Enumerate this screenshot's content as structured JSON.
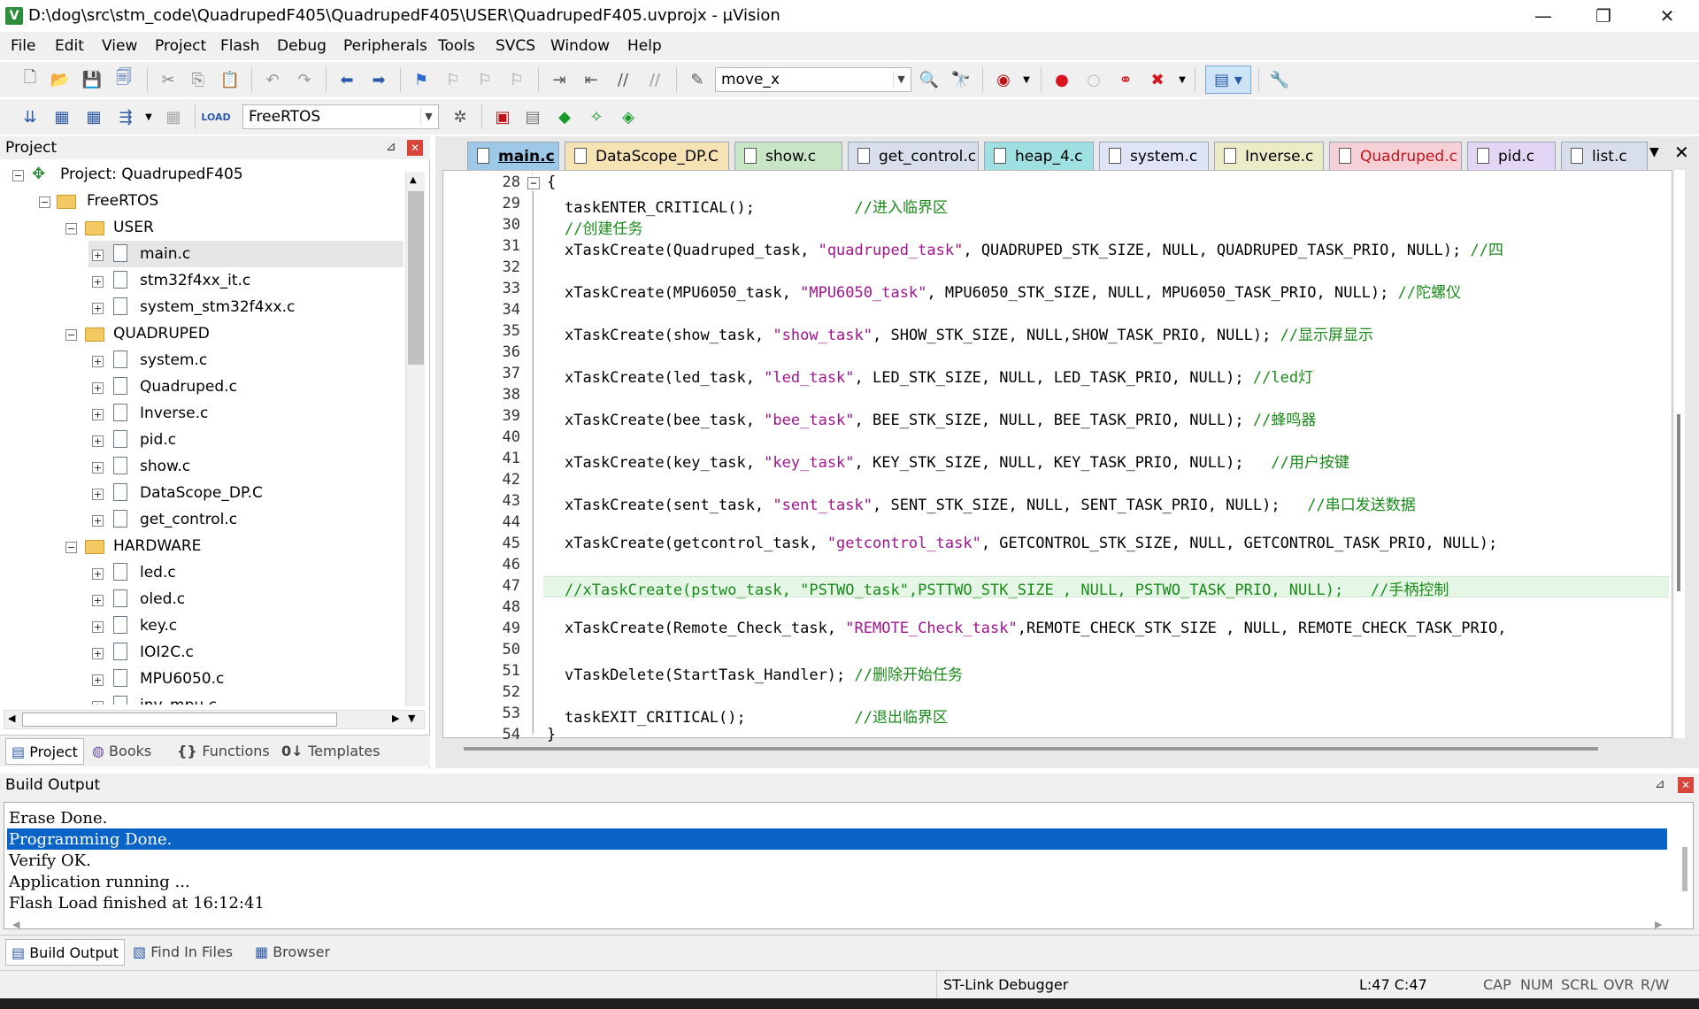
{
  "window": {
    "title": "D:\\dog\\src\\stm_code\\QuadrupedF405\\QuadrupedF405\\USER\\QuadrupedF405.uvprojx - µVision",
    "minimize": "—",
    "maximize": "❐",
    "close": "✕"
  },
  "menu": [
    "File",
    "Edit",
    "View",
    "Project",
    "Flash",
    "Debug",
    "Peripherals",
    "Tools",
    "SVCS",
    "Window",
    "Help"
  ],
  "toolbar": {
    "find_combo": "move_x",
    "target_combo": "FreeRTOS"
  },
  "project_panel": {
    "title": "Project",
    "root": "Project: QuadrupedF405",
    "target": "FreeRTOS",
    "groups": [
      {
        "name": "USER",
        "files": [
          "main.c",
          "stm32f4xx_it.c",
          "system_stm32f4xx.c"
        ]
      },
      {
        "name": "QUADRUPED",
        "files": [
          "system.c",
          "Quadruped.c",
          "Inverse.c",
          "pid.c",
          "show.c",
          "DataScope_DP.C",
          "get_control.c"
        ]
      },
      {
        "name": "HARDWARE",
        "files": [
          "led.c",
          "oled.c",
          "key.c",
          "IOI2C.c",
          "MPU6050.c",
          "inv_mpu.c"
        ]
      }
    ],
    "bottom_tabs": [
      "Project",
      "Books",
      "Functions",
      "Templates"
    ]
  },
  "editor": {
    "tabs": [
      {
        "label": "main.c",
        "color": "#9ec8e8"
      },
      {
        "label": "DataScope_DP.C",
        "color": "#f5e3b3"
      },
      {
        "label": "show.c",
        "color": "#c8e6c6"
      },
      {
        "label": "get_control.c",
        "color": "#d9dfea"
      },
      {
        "label": "heap_4.c",
        "color": "#9fe0e3"
      },
      {
        "label": "system.c",
        "color": "#dfe4f6"
      },
      {
        "label": "Inverse.c",
        "color": "#ebebc6"
      },
      {
        "label": "Quadruped.c",
        "color": "#f6d0d6"
      },
      {
        "label": "pid.c",
        "color": "#e3d6f4"
      },
      {
        "label": "list.c",
        "color": "#d9dfea"
      }
    ],
    "lines": [
      {
        "n": "28",
        "parts": [
          {
            "t": "{",
            "c": ""
          }
        ]
      },
      {
        "n": "29",
        "parts": [
          {
            "t": "taskENTER_CRITICAL();           ",
            "c": ""
          },
          {
            "t": "//进入临界区",
            "c": "cmt"
          }
        ]
      },
      {
        "n": "30",
        "parts": [
          {
            "t": "//创建任务",
            "c": "cmt"
          }
        ]
      },
      {
        "n": "31",
        "parts": [
          {
            "t": "xTaskCreate(Quadruped_task, ",
            "c": ""
          },
          {
            "t": "\"quadruped_task\"",
            "c": "str"
          },
          {
            "t": ", QUADRUPED_STK_SIZE, NULL, QUADRUPED_TASK_PRIO, NULL); ",
            "c": ""
          },
          {
            "t": "//四",
            "c": "cmt"
          }
        ]
      },
      {
        "n": "32",
        "parts": []
      },
      {
        "n": "33",
        "parts": [
          {
            "t": "xTaskCreate(MPU6050_task, ",
            "c": ""
          },
          {
            "t": "\"MPU6050_task\"",
            "c": "str"
          },
          {
            "t": ", MPU6050_STK_SIZE, NULL, MPU6050_TASK_PRIO, NULL); ",
            "c": ""
          },
          {
            "t": "//陀螺仪",
            "c": "cmt"
          }
        ]
      },
      {
        "n": "34",
        "parts": []
      },
      {
        "n": "35",
        "parts": [
          {
            "t": "xTaskCreate(show_task, ",
            "c": ""
          },
          {
            "t": "\"show_task\"",
            "c": "str"
          },
          {
            "t": ", SHOW_STK_SIZE, NULL,SHOW_TASK_PRIO, NULL); ",
            "c": ""
          },
          {
            "t": "//显示屏显示",
            "c": "cmt"
          }
        ]
      },
      {
        "n": "36",
        "parts": []
      },
      {
        "n": "37",
        "parts": [
          {
            "t": "xTaskCreate(led_task, ",
            "c": ""
          },
          {
            "t": "\"led_task\"",
            "c": "str"
          },
          {
            "t": ", LED_STK_SIZE, NULL, LED_TASK_PRIO, NULL); ",
            "c": ""
          },
          {
            "t": "//led灯",
            "c": "cmt"
          }
        ]
      },
      {
        "n": "38",
        "parts": []
      },
      {
        "n": "39",
        "parts": [
          {
            "t": "xTaskCreate(bee_task, ",
            "c": ""
          },
          {
            "t": "\"bee_task\"",
            "c": "str"
          },
          {
            "t": ", BEE_STK_SIZE, NULL, BEE_TASK_PRIO, NULL); ",
            "c": ""
          },
          {
            "t": "//蜂鸣器",
            "c": "cmt"
          }
        ]
      },
      {
        "n": "40",
        "parts": []
      },
      {
        "n": "41",
        "parts": [
          {
            "t": "xTaskCreate(key_task, ",
            "c": ""
          },
          {
            "t": "\"key_task\"",
            "c": "str"
          },
          {
            "t": ", KEY_STK_SIZE, NULL, KEY_TASK_PRIO, NULL);   ",
            "c": ""
          },
          {
            "t": "//用户按键",
            "c": "cmt"
          }
        ]
      },
      {
        "n": "42",
        "parts": []
      },
      {
        "n": "43",
        "parts": [
          {
            "t": "xTaskCreate(sent_task, ",
            "c": ""
          },
          {
            "t": "\"sent_task\"",
            "c": "str"
          },
          {
            "t": ", SENT_STK_SIZE, NULL, SENT_TASK_PRIO, NULL);   ",
            "c": ""
          },
          {
            "t": "//串口发送数据",
            "c": "cmt"
          }
        ]
      },
      {
        "n": "44",
        "parts": []
      },
      {
        "n": "45",
        "parts": [
          {
            "t": "xTaskCreate(getcontrol_task, ",
            "c": ""
          },
          {
            "t": "\"getcontrol_task\"",
            "c": "str"
          },
          {
            "t": ", GETCONTROL_STK_SIZE, NULL, GETCONTROL_TASK_PRIO, NULL);",
            "c": ""
          }
        ]
      },
      {
        "n": "46",
        "parts": []
      },
      {
        "n": "47",
        "parts": [
          {
            "t": "//xTaskCreate(pstwo_task, \"PSTWO_task\",PSTTWO_STK_SIZE , NULL, PSTWO_TASK_PRIO, NULL);   //手柄控制",
            "c": "cmt"
          }
        ],
        "highlight": true
      },
      {
        "n": "48",
        "parts": []
      },
      {
        "n": "49",
        "parts": [
          {
            "t": "xTaskCreate(Remote_Check_task, ",
            "c": ""
          },
          {
            "t": "\"REMOTE_Check_task\"",
            "c": "str"
          },
          {
            "t": ",REMOTE_CHECK_STK_SIZE , NULL, REMOTE_CHECK_TASK_PRIO,",
            "c": ""
          }
        ]
      },
      {
        "n": "50",
        "parts": []
      },
      {
        "n": "51",
        "parts": [
          {
            "t": "vTaskDelete(StartTask_Handler); ",
            "c": ""
          },
          {
            "t": "//删除开始任务",
            "c": "cmt"
          }
        ]
      },
      {
        "n": "52",
        "parts": []
      },
      {
        "n": "53",
        "parts": [
          {
            "t": "taskEXIT_CRITICAL();            ",
            "c": ""
          },
          {
            "t": "//退出临界区",
            "c": "cmt"
          }
        ]
      },
      {
        "n": "54",
        "parts": [
          {
            "t": "}",
            "c": ""
          }
        ]
      }
    ]
  },
  "build_output": {
    "title": "Build Output",
    "lines": [
      "Erase Done.",
      "Programming Done.",
      "Verify OK.",
      "Application running ...",
      "Flash Load finished at 16:12:41"
    ],
    "selected_line": 1,
    "tabs": [
      "Build Output",
      "Find In Files",
      "Browser"
    ]
  },
  "status": {
    "debugger": "ST-Link Debugger",
    "position": "L:47 C:47",
    "indicators": [
      "CAP",
      "NUM",
      "SCRL",
      "OVR",
      "R/W"
    ]
  }
}
